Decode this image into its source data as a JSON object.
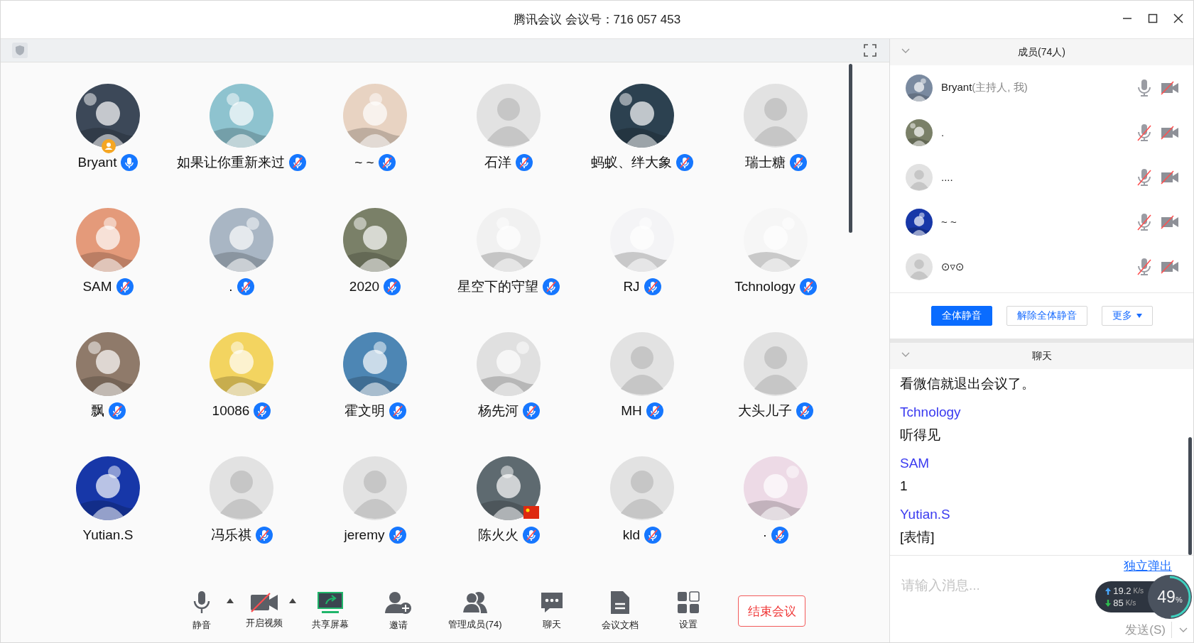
{
  "window": {
    "title": "腾讯会议 会议号：716 057 453"
  },
  "participants": [
    {
      "name": "Bryant",
      "photo": true,
      "mic_visible": true,
      "muted": false,
      "host": true,
      "flag": false
    },
    {
      "name": "如果让你重新来过",
      "photo": true,
      "mic_visible": true,
      "muted": true,
      "host": false,
      "flag": false
    },
    {
      "name": "~ ~",
      "photo": true,
      "mic_visible": true,
      "muted": true,
      "host": false,
      "flag": false
    },
    {
      "name": "石洋",
      "photo": false,
      "mic_visible": true,
      "muted": true,
      "host": false,
      "flag": false
    },
    {
      "name": "蚂蚁、绊大象",
      "photo": true,
      "mic_visible": true,
      "muted": true,
      "host": false,
      "flag": false
    },
    {
      "name": "瑞士糖",
      "photo": false,
      "mic_visible": true,
      "muted": true,
      "host": false,
      "flag": false
    },
    {
      "name": "SAM",
      "photo": true,
      "mic_visible": true,
      "muted": true,
      "host": false,
      "flag": false
    },
    {
      "name": ".",
      "photo": true,
      "mic_visible": true,
      "muted": true,
      "host": false,
      "flag": false
    },
    {
      "name": "2020",
      "photo": true,
      "mic_visible": true,
      "muted": true,
      "host": false,
      "flag": false
    },
    {
      "name": "星空下的守望",
      "photo": true,
      "mic_visible": true,
      "muted": true,
      "host": false,
      "flag": false
    },
    {
      "name": "RJ",
      "photo": true,
      "mic_visible": true,
      "muted": true,
      "host": false,
      "flag": false
    },
    {
      "name": "Tchnology",
      "photo": true,
      "mic_visible": true,
      "muted": true,
      "host": false,
      "flag": false
    },
    {
      "name": "飘",
      "photo": true,
      "mic_visible": true,
      "muted": true,
      "host": false,
      "flag": false
    },
    {
      "name": "10086",
      "photo": true,
      "mic_visible": true,
      "muted": true,
      "host": false,
      "flag": false
    },
    {
      "name": "霍文明",
      "photo": true,
      "mic_visible": true,
      "muted": true,
      "host": false,
      "flag": false
    },
    {
      "name": "杨先河",
      "photo": true,
      "mic_visible": true,
      "muted": true,
      "host": false,
      "flag": false
    },
    {
      "name": "MH",
      "photo": false,
      "mic_visible": true,
      "muted": true,
      "host": false,
      "flag": false
    },
    {
      "name": "大头儿子",
      "photo": false,
      "mic_visible": true,
      "muted": true,
      "host": false,
      "flag": false
    },
    {
      "name": "Yutian.S",
      "photo": true,
      "mic_visible": false,
      "host": false,
      "flag": false
    },
    {
      "name": "冯乐祺",
      "photo": false,
      "mic_visible": true,
      "muted": true,
      "host": false,
      "flag": false
    },
    {
      "name": "jeremy",
      "photo": false,
      "mic_visible": true,
      "muted": true,
      "host": false,
      "flag": false
    },
    {
      "name": "陈火火",
      "photo": true,
      "mic_visible": true,
      "muted": true,
      "host": false,
      "flag": true
    },
    {
      "name": "kld",
      "photo": false,
      "mic_visible": true,
      "muted": true,
      "host": false,
      "flag": false
    },
    {
      "name": "·",
      "photo": true,
      "mic_visible": true,
      "muted": true,
      "host": false,
      "flag": false
    }
  ],
  "toolbar": [
    {
      "kind": "mic",
      "label": "静音",
      "has_menu": true
    },
    {
      "kind": "video",
      "label": "开启视频",
      "has_menu": true
    },
    {
      "kind": "share",
      "label": "共享屏幕",
      "has_menu": false
    },
    {
      "kind": "invite",
      "label": "邀请",
      "has_menu": false
    },
    {
      "kind": "members",
      "label": "管理成员(74)",
      "has_menu": false
    },
    {
      "kind": "chat",
      "label": "聊天",
      "has_menu": false
    },
    {
      "kind": "docs",
      "label": "会议文档",
      "has_menu": false
    },
    {
      "kind": "settings",
      "label": "设置",
      "has_menu": false
    }
  ],
  "end_button": "结束会议",
  "members_panel": {
    "title": "成员(74人)",
    "members": [
      {
        "name": "Bryant",
        "note": "(主持人, 我)",
        "photo": true,
        "muted": false
      },
      {
        "name": ".",
        "photo": true,
        "muted": true
      },
      {
        "name": "....",
        "photo": false,
        "muted": true
      },
      {
        "name": "~ ~",
        "photo": true,
        "muted": true
      },
      {
        "name": "⊙▿⊙",
        "photo": false,
        "muted": true
      }
    ],
    "buttons": [
      {
        "label": "全体静音",
        "primary": true,
        "caret": false
      },
      {
        "label": "解除全体静音",
        "primary": false,
        "caret": false
      },
      {
        "label": "更多",
        "primary": false,
        "caret": true
      }
    ]
  },
  "chat_panel": {
    "title": "聊天",
    "messages": [
      {
        "kind": "text",
        "text": "看微信就退出会议了。"
      },
      {
        "kind": "sender",
        "text": "Tchnology"
      },
      {
        "kind": "text",
        "text": "听得见"
      },
      {
        "kind": "sender",
        "text": "SAM"
      },
      {
        "kind": "text",
        "text": "1"
      },
      {
        "kind": "sender",
        "text": "Yutian.S"
      },
      {
        "kind": "text",
        "text": "[表情]"
      }
    ],
    "popout_link": "独立弹出",
    "placeholder": "请输入消息...",
    "send_button": "发送(S)"
  },
  "network": {
    "upload": "19.2",
    "upload_unit": "K/s",
    "download": "85",
    "download_unit": "K/s",
    "percent": "49",
    "percent_unit": "%",
    "level": 0.49
  }
}
